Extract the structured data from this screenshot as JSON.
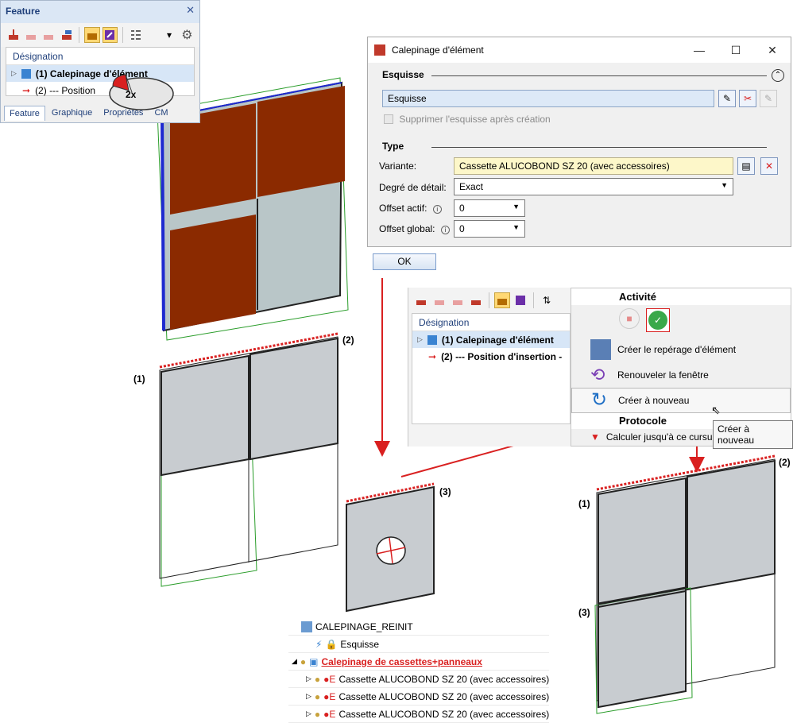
{
  "feature_panel": {
    "title": "Feature",
    "close_icon": "close-icon",
    "tree_header": "Désignation",
    "rows": [
      {
        "label": "(1) Calepinage d'élément"
      },
      {
        "label": "(2) --- Position"
      }
    ],
    "tabs": [
      "Feature",
      "Graphique",
      "Propriétés",
      "CM"
    ],
    "mouse_badge": "2x"
  },
  "dialog": {
    "title": "Calepinage d'élément",
    "esquisse_group": "Esquisse",
    "esquisse_value": "Esquisse",
    "delete_sketch_label": "Supprimer l'esquisse après création",
    "type_group": "Type",
    "variante_label": "Variante:",
    "variante_value": "Cassette ALUCOBOND SZ 20 (avec accessoires)",
    "detail_label": "Degré de détail:",
    "detail_value": "Exact",
    "offset_actif_label": "Offset actif:",
    "offset_actif_value": "0",
    "offset_global_label": "Offset global:",
    "offset_global_value": "0",
    "ok_label": "OK"
  },
  "panel2": {
    "tree_header": "Désignation",
    "rows": [
      {
        "label": "(1) Calepinage d'élément"
      },
      {
        "label": "(2) --- Position d'insertion -"
      }
    ]
  },
  "context_menu": {
    "header": "Activité",
    "items": [
      {
        "label": "Créer le repérage d'élément"
      },
      {
        "label": "Renouveler la fenêtre"
      },
      {
        "label": "Créer à nouveau"
      }
    ],
    "section2": "Protocole",
    "partial_item": "Calculer jusqu'à ce cursuer",
    "tooltip": "Créer à nouveau"
  },
  "bottom_tree": {
    "root": "CALEPINAGE_REINIT",
    "sketch": "Esquisse",
    "group": "Calepinage de cassettes+panneaux",
    "items": [
      "Cassette ALUCOBOND SZ 20 (avec accessoires)",
      "Cassette ALUCOBOND SZ 20 (avec accessoires)",
      "Cassette ALUCOBOND SZ 20 (avec accessoires)"
    ]
  },
  "labels_3d": {
    "a_2": "(2)",
    "a_1": "(1)",
    "b_3": "(3)",
    "c_2": "(2)",
    "c_1": "(1)",
    "c_3": "(3)"
  },
  "colors": {
    "panel_brown": "#8b2a00",
    "panel_grey": "#c8ccd0",
    "arrow_red": "#d92020",
    "accent_blue": "#1f3f7a"
  }
}
